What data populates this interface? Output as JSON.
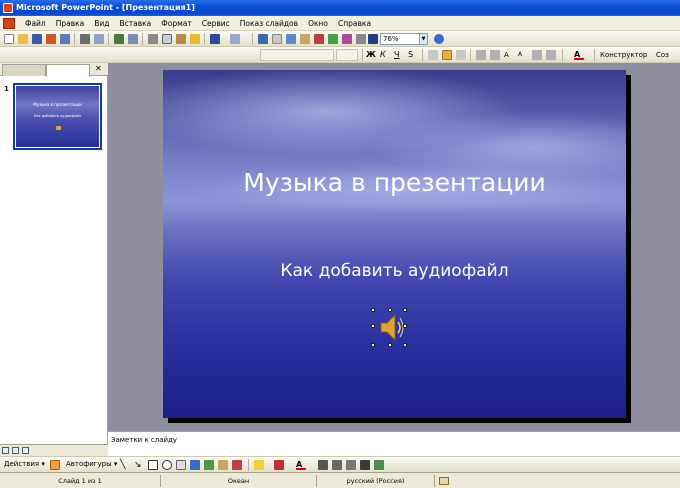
{
  "window": {
    "title": "Microsoft PowerPoint - [Презентация1]"
  },
  "menu": {
    "items": [
      {
        "label": "Файл"
      },
      {
        "label": "Правка"
      },
      {
        "label": "Вид"
      },
      {
        "label": "Вставка"
      },
      {
        "label": "Формат"
      },
      {
        "label": "Сервис"
      },
      {
        "label": "Показ слайдов"
      },
      {
        "label": "Окно"
      },
      {
        "label": "Справка"
      }
    ]
  },
  "toolbar": {
    "zoom": "76%",
    "designer_label": "Конструктор",
    "create_label": "Соз"
  },
  "pane": {
    "slide_number": "1"
  },
  "thumbnail": {
    "title": "Музыка в презентации",
    "subtitle": "Как добавить аудиофайл"
  },
  "slide": {
    "title": "Музыка в презентации",
    "subtitle": "Как добавить аудиофайл"
  },
  "notes": {
    "placeholder": "Заметки к слайду"
  },
  "drawing": {
    "actions_label": "Действия",
    "autoshapes_label": "Автофигуры"
  },
  "status": {
    "slide_info": "Слайд 1 из 1",
    "design": "Океан",
    "language": "русский (Россия)"
  },
  "colors": {
    "titlebar": "#0a4fd4",
    "slide_background": "#4248ae",
    "workspace": "#8e8e9e"
  },
  "icons": [
    "app-icon",
    "new-icon",
    "open-icon",
    "save-icon",
    "print-icon",
    "spellcheck-icon",
    "cut-icon",
    "copy-icon",
    "paste-icon",
    "undo-icon",
    "redo-icon",
    "bold-icon",
    "italic-icon",
    "underline-icon",
    "align-left-icon",
    "align-center-icon",
    "align-right-icon",
    "font-color-icon",
    "speaker-icon",
    "close-icon"
  ]
}
